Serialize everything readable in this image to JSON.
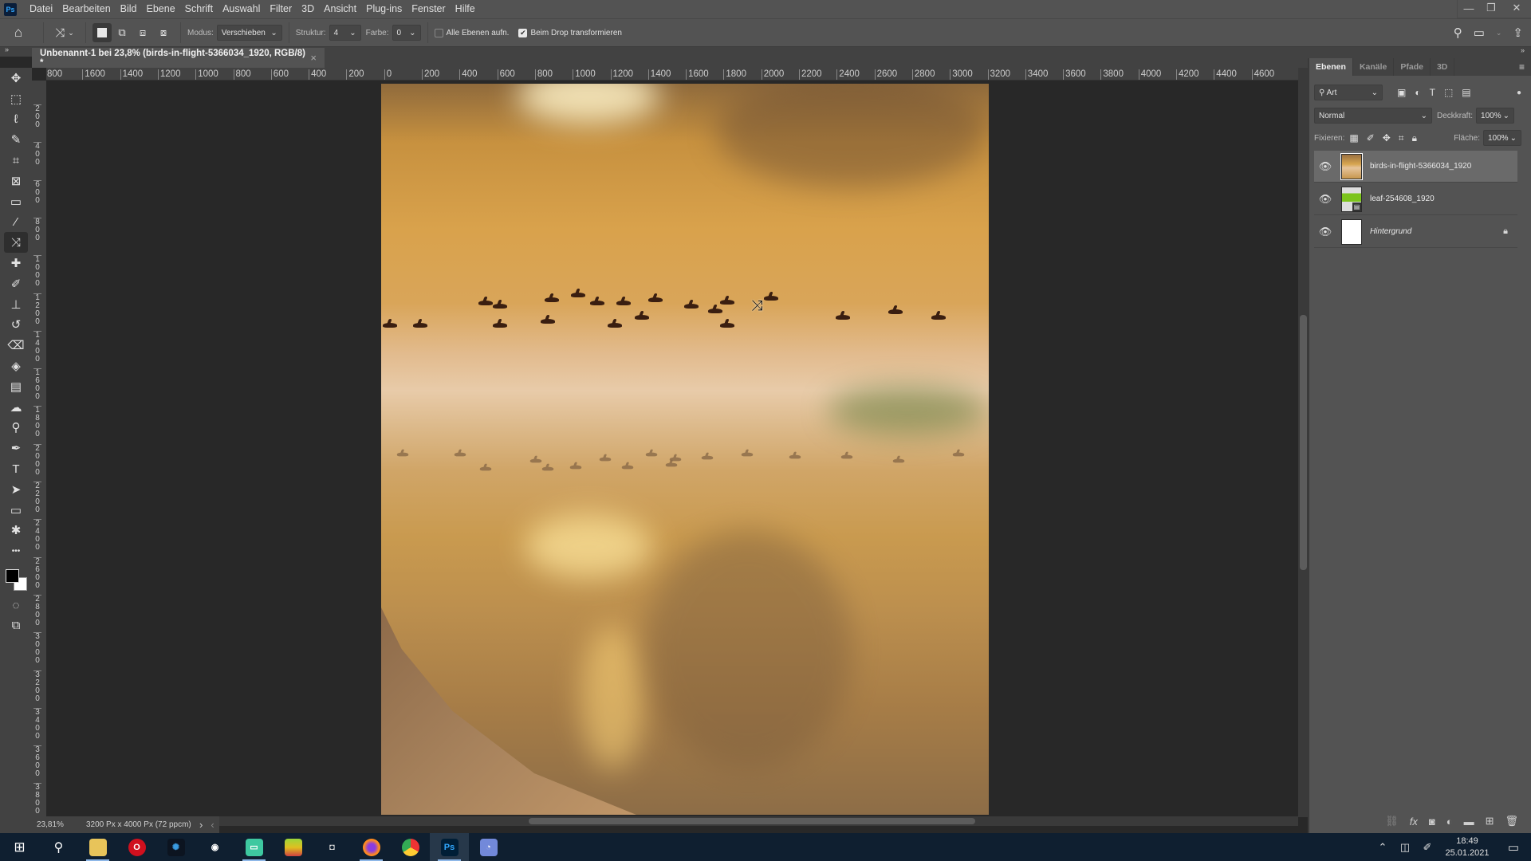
{
  "app": {
    "logo": "Ps",
    "name": "Adobe Photoshop"
  },
  "menubar": {
    "items": [
      "Datei",
      "Bearbeiten",
      "Bild",
      "Ebene",
      "Schrift",
      "Auswahl",
      "Filter",
      "3D",
      "Ansicht",
      "Plug-ins",
      "Fenster",
      "Hilfe"
    ],
    "window_controls": {
      "minimize": "—",
      "restore": "❐",
      "close": "✕"
    }
  },
  "options": {
    "modus_label": "Modus:",
    "modus_value": "Verschieben",
    "struktur_label": "Struktur:",
    "struktur_value": "4",
    "farbe_label": "Farbe:",
    "farbe_value": "0",
    "alle_ebenen_label": "Alle Ebenen aufn.",
    "alle_ebenen_checked": false,
    "beim_drop_label": "Beim Drop transformieren",
    "beim_drop_checked": true
  },
  "document": {
    "tab_title": "Unbenannt-1 bei 23,8% (birds-in-flight-5366034_1920, RGB/8) *",
    "close": "×"
  },
  "rulers": {
    "horizontal": [
      "800",
      "1600",
      "1400",
      "1200",
      "1000",
      "800",
      "600",
      "400",
      "200",
      "0",
      "200",
      "400",
      "600",
      "800",
      "1000",
      "1200",
      "1400",
      "1600",
      "1800",
      "2000",
      "2200",
      "2400",
      "2600",
      "2800",
      "3000",
      "3200",
      "3400",
      "3600",
      "3800",
      "4000",
      "4200",
      "4400",
      "4600"
    ],
    "vertical": [
      "2\n0\n0",
      "4\n0\n0",
      "6\n0\n0",
      "8\n0\n0",
      "1\n0\n0\n0",
      "1\n2\n0\n0",
      "1\n4\n0\n0",
      "1\n6\n0\n0",
      "1\n8\n0\n0",
      "2\n0\n0\n0",
      "2\n2\n0\n0",
      "2\n4\n0\n0",
      "2\n6\n0\n0",
      "2\n8\n0\n0",
      "3\n0\n0\n0",
      "3\n2\n0\n0",
      "3\n4\n0\n0",
      "3\n6\n0\n0",
      "3\n8\n0\n0"
    ]
  },
  "tools": [
    {
      "name": "move-tool",
      "glyph": "✥"
    },
    {
      "name": "marquee-tool",
      "glyph": "⬚"
    },
    {
      "name": "lasso-tool",
      "glyph": "ℓ"
    },
    {
      "name": "quick-selection-tool",
      "glyph": "✎"
    },
    {
      "name": "crop-tool",
      "glyph": "⌗"
    },
    {
      "name": "frame-tool",
      "glyph": "⊠"
    },
    {
      "name": "ruler-tool",
      "glyph": "▭"
    },
    {
      "name": "eyedropper-tool",
      "glyph": "⁄"
    },
    {
      "name": "content-aware-move-tool",
      "glyph": "⤨",
      "active": true
    },
    {
      "name": "healing-brush-tool",
      "glyph": "✚"
    },
    {
      "name": "brush-tool",
      "glyph": "✐"
    },
    {
      "name": "clone-stamp-tool",
      "glyph": "⊥"
    },
    {
      "name": "history-brush-tool",
      "glyph": "↺"
    },
    {
      "name": "eraser-tool",
      "glyph": "⌫"
    },
    {
      "name": "paint-bucket-tool",
      "glyph": "◈"
    },
    {
      "name": "gradient-tool",
      "glyph": "▤"
    },
    {
      "name": "blur-tool",
      "glyph": "☁"
    },
    {
      "name": "dodge-tool",
      "glyph": "⚲"
    },
    {
      "name": "pen-tool",
      "glyph": "✒"
    },
    {
      "name": "type-tool",
      "glyph": "T"
    },
    {
      "name": "path-selection-tool",
      "glyph": "➤"
    },
    {
      "name": "rectangle-tool",
      "glyph": "▭"
    },
    {
      "name": "custom-shape-tool",
      "glyph": "✱"
    },
    {
      "name": "more-tools",
      "glyph": "•••"
    }
  ],
  "colors": {
    "foreground": "#000000",
    "background": "#ffffff",
    "accent": "#31a8ff"
  },
  "status": {
    "zoom": "23,81%",
    "doc_size": "3200 Px x 4000 Px (72 ppcm)",
    "next": "›",
    "prev": "‹"
  },
  "layers_panel": {
    "tabs": [
      "Ebenen",
      "Kanäle",
      "Pfade",
      "3D"
    ],
    "active_tab": 0,
    "filter_label": "Art",
    "blend_mode": "Normal",
    "opacity_label": "Deckkraft:",
    "opacity_value": "100%",
    "lock_label": "Fixieren:",
    "fill_label": "Fläche:",
    "fill_value": "100%",
    "layers": [
      {
        "name": "birds-in-flight-5366034_1920",
        "visible": true,
        "selected": true,
        "italic": false,
        "locked": false,
        "smart_object": false
      },
      {
        "name": "leaf-254608_1920",
        "visible": true,
        "selected": false,
        "italic": false,
        "locked": false,
        "smart_object": true
      },
      {
        "name": "Hintergrund",
        "visible": true,
        "selected": false,
        "italic": true,
        "locked": true,
        "smart_object": false
      }
    ]
  },
  "taskbar": {
    "apps": [
      "Start",
      "Suche",
      "Datei-Explorer",
      "Opera",
      "Battle.net",
      "Steam",
      "Discord Bot",
      "BlueStacks",
      "GameBar",
      "Firefox",
      "Chrome",
      "Photoshop",
      "Discord"
    ],
    "time": "18:49",
    "date": "25.01.2021"
  }
}
